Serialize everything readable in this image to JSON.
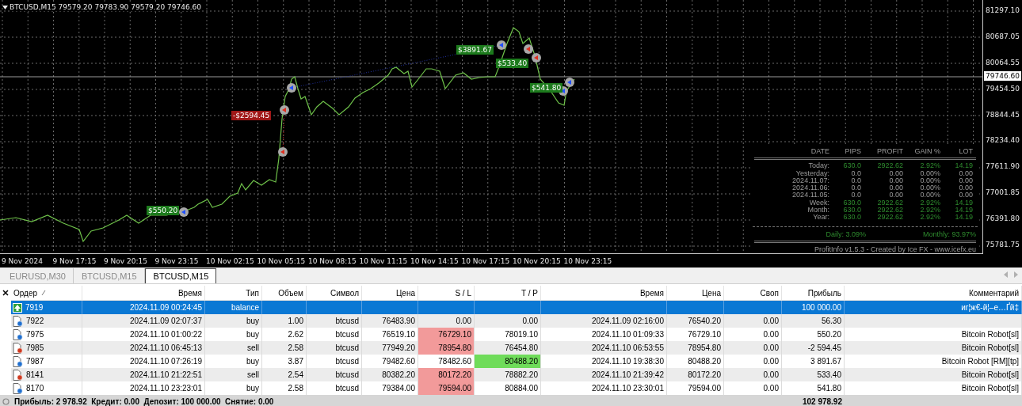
{
  "chart": {
    "title": "BTCUSD,M15  79579.20 79783.90 79579.20 79746.60",
    "price_labels": [
      "81297.10",
      "80687.05",
      "80064.55",
      "79454.50",
      "78844.45",
      "78234.40",
      "77611.90",
      "77001.85",
      "76391.80",
      "75781.75"
    ],
    "current_price": "79746.60",
    "time_labels": [
      "9 Nov 2024",
      "9 Nov 17:15",
      "9 Nov 20:15",
      "9 Nov 23:15",
      "10 Nov 02:15",
      "10 Nov 05:15",
      "10 Nov 08:15",
      "10 Nov 11:15",
      "10 Nov 14:15",
      "10 Nov 17:15",
      "10 Nov 20:15",
      "10 Nov 23:15"
    ],
    "trade_labels": [
      {
        "text": "$550.20",
        "kind": "profit"
      },
      {
        "text": "-$2594.45",
        "kind": "loss"
      },
      {
        "text": "$3891.67",
        "kind": "profit"
      },
      {
        "text": "$533.40",
        "kind": "profit"
      },
      {
        "text": "$541.80",
        "kind": "profit"
      }
    ]
  },
  "stats": {
    "columns": [
      "DATE",
      "PIPS",
      "PROFIT",
      "GAIN %",
      "LOT"
    ],
    "rows": [
      {
        "label": "Today:",
        "pips": "630.0",
        "profit": "2922.62",
        "gain": "2.92%",
        "lot": "14.19",
        "positive": true
      },
      {
        "label": "Yesterday:",
        "pips": "0.0",
        "profit": "0.00",
        "gain": "0.00%",
        "lot": "0.00",
        "positive": false
      },
      {
        "label": "2024.11.07:",
        "pips": "0.0",
        "profit": "0.00",
        "gain": "0.00%",
        "lot": "0.00",
        "positive": false
      },
      {
        "label": "2024.11.06:",
        "pips": "0.0",
        "profit": "0.00",
        "gain": "0.00%",
        "lot": "0.00",
        "positive": false
      },
      {
        "label": "2024.11.05:",
        "pips": "0.0",
        "profit": "0.00",
        "gain": "0.00%",
        "lot": "0.00",
        "positive": false
      },
      {
        "label": "Week:",
        "pips": "630.0",
        "profit": "2922.62",
        "gain": "2.92%",
        "lot": "14.19",
        "positive": true
      },
      {
        "label": "Month:",
        "pips": "630.0",
        "profit": "2922.62",
        "gain": "2.92%",
        "lot": "14.19",
        "positive": true
      },
      {
        "label": "Year:",
        "pips": "630.0",
        "profit": "2922.62",
        "gain": "2.92%",
        "lot": "14.19",
        "positive": true
      }
    ],
    "daily": "Daily: 3.09%",
    "monthly": "Monthly: 93.97%",
    "credit": "ProfitInfo v1.5.3 - Created by Ice FX - www.icefx.eu"
  },
  "tabs": [
    {
      "label": "EURUSD,M30",
      "selected": false
    },
    {
      "label": "BTCUSD,M15",
      "selected": false
    },
    {
      "label": "BTCUSD,M15",
      "selected": true
    }
  ],
  "table": {
    "columns": [
      "Ордер",
      "Время",
      "Тип",
      "Объем",
      "Символ",
      "Цена",
      "S / L",
      "T / P",
      "Время",
      "Цена",
      "Своп",
      "Прибыль",
      "Комментарий"
    ],
    "rows": [
      {
        "order": "7919",
        "kind": "balance",
        "time": "2024.11.09 00:24:45",
        "type": "balance",
        "profit": "100 000.00",
        "comment": "иг¦ж€-й¦–е…Ґй‡",
        "selected": true
      },
      {
        "order": "7922",
        "kind": "buy",
        "time": "2024.11.09 02:07:37",
        "type": "buy",
        "volume": "1.00",
        "symbol": "btcusd",
        "price": "76483.90",
        "sl": "0.00",
        "tp": "0.00",
        "close_time": "2024.11.09 02:16:00",
        "close_price": "76540.20",
        "swap": "0.00",
        "profit": "56.30",
        "sl_hit": false,
        "tp_hit": false,
        "selected": false
      },
      {
        "order": "7975",
        "kind": "buy",
        "time": "2024.11.10 01:00:22",
        "type": "buy",
        "volume": "2.62",
        "symbol": "btcusd",
        "price": "76519.10",
        "sl": "76729.10",
        "tp": "78019.10",
        "close_time": "2024.11.10 01:09:33",
        "close_price": "76729.10",
        "swap": "0.00",
        "profit": "550.20",
        "comment": "Bitcoin Robot[sl]",
        "sl_hit": true,
        "tp_hit": false,
        "selected": false
      },
      {
        "order": "7985",
        "kind": "sell",
        "time": "2024.11.10 06:45:13",
        "type": "sell",
        "volume": "2.58",
        "symbol": "btcusd",
        "price": "77949.20",
        "sl": "78954.80",
        "tp": "76454.80",
        "close_time": "2024.11.10 06:53:55",
        "close_price": "78954.80",
        "swap": "0.00",
        "profit": "-2 594.45",
        "comment": "Bitcoin Robot[sl]",
        "sl_hit": true,
        "tp_hit": false,
        "selected": false
      },
      {
        "order": "7987",
        "kind": "buy",
        "time": "2024.11.10 07:26:19",
        "type": "buy",
        "volume": "3.87",
        "symbol": "btcusd",
        "price": "79482.60",
        "sl": "78482.60",
        "tp": "80488.20",
        "close_time": "2024.11.10 19:38:30",
        "close_price": "80488.20",
        "swap": "0.00",
        "profit": "3 891.67",
        "comment": "Bitcoin Robot [RM][tp]",
        "sl_hit": false,
        "tp_hit": true,
        "selected": false
      },
      {
        "order": "8141",
        "kind": "sell",
        "time": "2024.11.10 21:22:51",
        "type": "sell",
        "volume": "2.54",
        "symbol": "btcusd",
        "price": "80382.20",
        "sl": "80172.20",
        "tp": "78882.20",
        "close_time": "2024.11.10 21:39:42",
        "close_price": "80172.20",
        "swap": "0.00",
        "profit": "533.40",
        "comment": "Bitcoin Robot[sl]",
        "sl_hit": true,
        "tp_hit": false,
        "selected": false
      },
      {
        "order": "8170",
        "kind": "buy",
        "time": "2024.11.10 23:23:01",
        "type": "buy",
        "volume": "2.58",
        "symbol": "btcusd",
        "price": "79384.00",
        "sl": "79594.00",
        "tp": "80884.00",
        "close_time": "2024.11.10 23:30:01",
        "close_price": "79594.00",
        "swap": "0.00",
        "profit": "541.80",
        "comment": "Bitcoin Robot[sl]",
        "sl_hit": true,
        "tp_hit": false,
        "selected": false
      }
    ],
    "footer": {
      "summary": "Прибыль: 2 978.92  Кредит: 0.00  Депозит: 100 000.00  Снятие: 0.00",
      "total": "102 978.92"
    }
  }
}
